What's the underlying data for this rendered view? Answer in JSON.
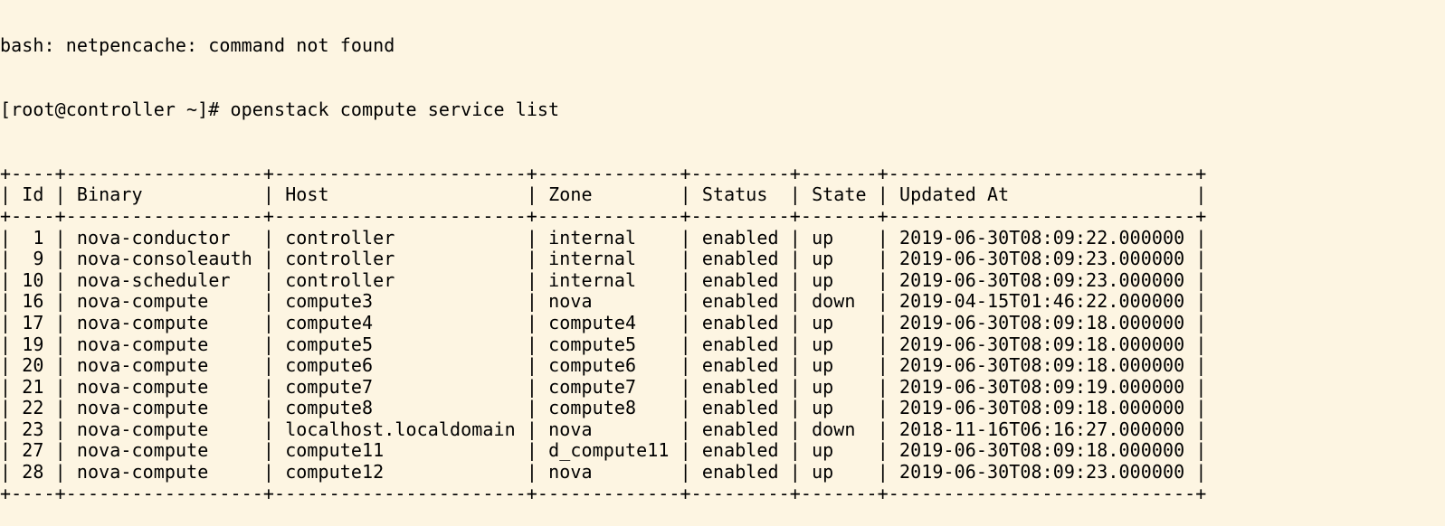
{
  "prev_output": "bash: netpencache: command not found",
  "prompt": "[root@controller ~]# ",
  "command": "openstack compute service list",
  "table": {
    "columns": [
      "Id",
      "Binary",
      "Host",
      "Zone",
      "Status",
      "State",
      "Updated At"
    ],
    "rows": [
      [
        "1",
        "nova-conductor",
        "controller",
        "internal",
        "enabled",
        "up",
        "2019-06-30T08:09:22.000000"
      ],
      [
        "9",
        "nova-consoleauth",
        "controller",
        "internal",
        "enabled",
        "up",
        "2019-06-30T08:09:23.000000"
      ],
      [
        "10",
        "nova-scheduler",
        "controller",
        "internal",
        "enabled",
        "up",
        "2019-06-30T08:09:23.000000"
      ],
      [
        "16",
        "nova-compute",
        "compute3",
        "nova",
        "enabled",
        "down",
        "2019-04-15T01:46:22.000000"
      ],
      [
        "17",
        "nova-compute",
        "compute4",
        "compute4",
        "enabled",
        "up",
        "2019-06-30T08:09:18.000000"
      ],
      [
        "19",
        "nova-compute",
        "compute5",
        "compute5",
        "enabled",
        "up",
        "2019-06-30T08:09:18.000000"
      ],
      [
        "20",
        "nova-compute",
        "compute6",
        "compute6",
        "enabled",
        "up",
        "2019-06-30T08:09:18.000000"
      ],
      [
        "21",
        "nova-compute",
        "compute7",
        "compute7",
        "enabled",
        "up",
        "2019-06-30T08:09:19.000000"
      ],
      [
        "22",
        "nova-compute",
        "compute8",
        "compute8",
        "enabled",
        "up",
        "2019-06-30T08:09:18.000000"
      ],
      [
        "23",
        "nova-compute",
        "localhost.localdomain",
        "nova",
        "enabled",
        "down",
        "2018-11-16T06:16:27.000000"
      ],
      [
        "27",
        "nova-compute",
        "compute11",
        "d_compute11",
        "enabled",
        "up",
        "2019-06-30T08:09:18.000000"
      ],
      [
        "28",
        "nova-compute",
        "compute12",
        "nova",
        "enabled",
        "up",
        "2019-06-30T08:09:23.000000"
      ]
    ]
  },
  "colors": {
    "background": "#fdf5e2",
    "text": "#000000"
  }
}
